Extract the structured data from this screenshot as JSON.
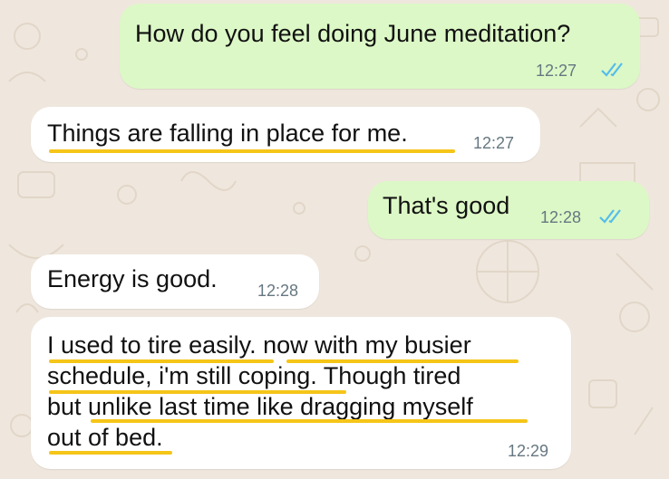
{
  "chat": {
    "colors": {
      "outgoing_bubble": "#dcf8c6",
      "incoming_bubble": "#ffffff",
      "read_ticks": "#53bdeb",
      "highlight_underline": "#f5c518",
      "background": "#efe7dd"
    },
    "messages": [
      {
        "direction": "outgoing",
        "text": "How do you feel doing June meditation?",
        "time": "12:27",
        "status_icon": "double-check-read-icon"
      },
      {
        "direction": "incoming",
        "text": "Things are falling in place for me.",
        "time": "12:27"
      },
      {
        "direction": "outgoing",
        "text": "That's good",
        "time": "12:28",
        "status_icon": "double-check-read-icon"
      },
      {
        "direction": "incoming",
        "text": "Energy is good.",
        "time": "12:28"
      },
      {
        "direction": "incoming",
        "lines": [
          "I used to tire easily. now with my busier",
          "schedule, i'm still coping. Though tired",
          "but unlike last time like dragging myself",
          "out of bed."
        ],
        "time": "12:29"
      }
    ]
  }
}
